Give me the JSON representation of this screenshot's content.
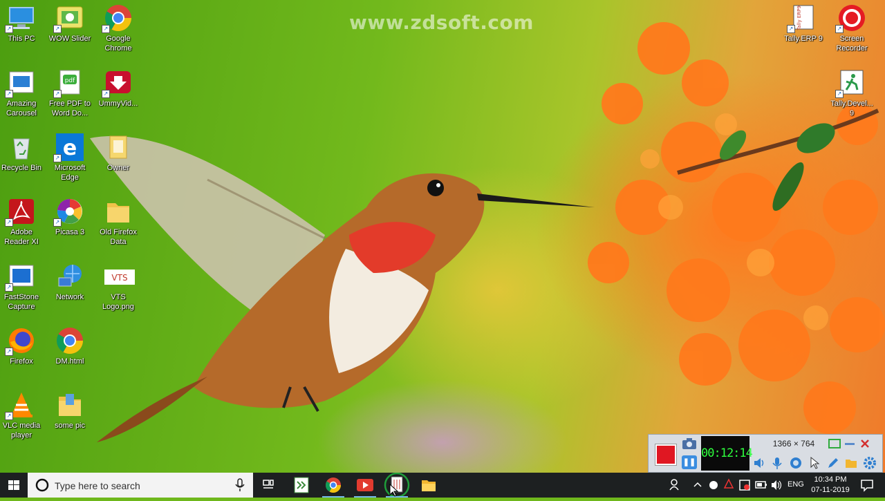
{
  "wallpaper": {
    "watermark": "www.zdsoft.com"
  },
  "desktop_icons": [
    {
      "label": "This PC",
      "icon": "this-pc-icon"
    },
    {
      "label": "WOW Slider",
      "icon": "wow-slider-icon"
    },
    {
      "label": "Google Chrome",
      "icon": "chrome-icon"
    },
    {
      "label": "Amazing Carousel",
      "icon": "amazing-carousel-icon"
    },
    {
      "label": "Free PDF to Word Do...",
      "icon": "pdf-to-word-icon"
    },
    {
      "label": "UmmyVid...",
      "icon": "ummy-video-icon"
    },
    {
      "label": "Recycle Bin",
      "icon": "recycle-bin-icon"
    },
    {
      "label": "Microsoft Edge",
      "icon": "edge-icon"
    },
    {
      "label": "Owner",
      "icon": "owner-folder-icon"
    },
    {
      "label": "Adobe Reader XI",
      "icon": "adobe-reader-icon"
    },
    {
      "label": "Picasa 3",
      "icon": "picasa-icon"
    },
    {
      "label": "Old Firefox Data",
      "icon": "folder-icon"
    },
    {
      "label": "FastStone Capture",
      "icon": "faststone-icon"
    },
    {
      "label": "Network",
      "icon": "network-icon"
    },
    {
      "label": "VTS Logo.png",
      "icon": "vts-logo-icon",
      "badge": "VTS"
    },
    {
      "label": "Firefox",
      "icon": "firefox-icon"
    },
    {
      "label": "DM.html",
      "icon": "chrome-html-icon"
    },
    {
      "label": "VLC media player",
      "icon": "vlc-icon"
    },
    {
      "label": "some pic",
      "icon": "folder-icon"
    },
    {
      "label": "Tally.ERP 9",
      "icon": "tally-erp-icon",
      "badge": "Tally ERP9"
    },
    {
      "label": "Screen Recorder",
      "icon": "screen-recorder-icon"
    },
    {
      "label": "Tally.Devel... 9",
      "icon": "tally-developer-icon"
    }
  ],
  "recorder": {
    "timer": "00:12:14",
    "resolution": "1366 × 764"
  },
  "taskbar": {
    "search_placeholder": "Type here to search",
    "apps": [
      "task-view",
      "tally-taskbar",
      "chrome-taskbar",
      "recorder-taskbar",
      "tally-erp-taskbar",
      "file-explorer-taskbar"
    ],
    "language": "ENG",
    "time": "10:34 PM",
    "date": "07-11-2019"
  },
  "colors": {
    "taskbar": "#1d2021",
    "record_red": "#e01722",
    "timer_green": "#2fff3e"
  }
}
